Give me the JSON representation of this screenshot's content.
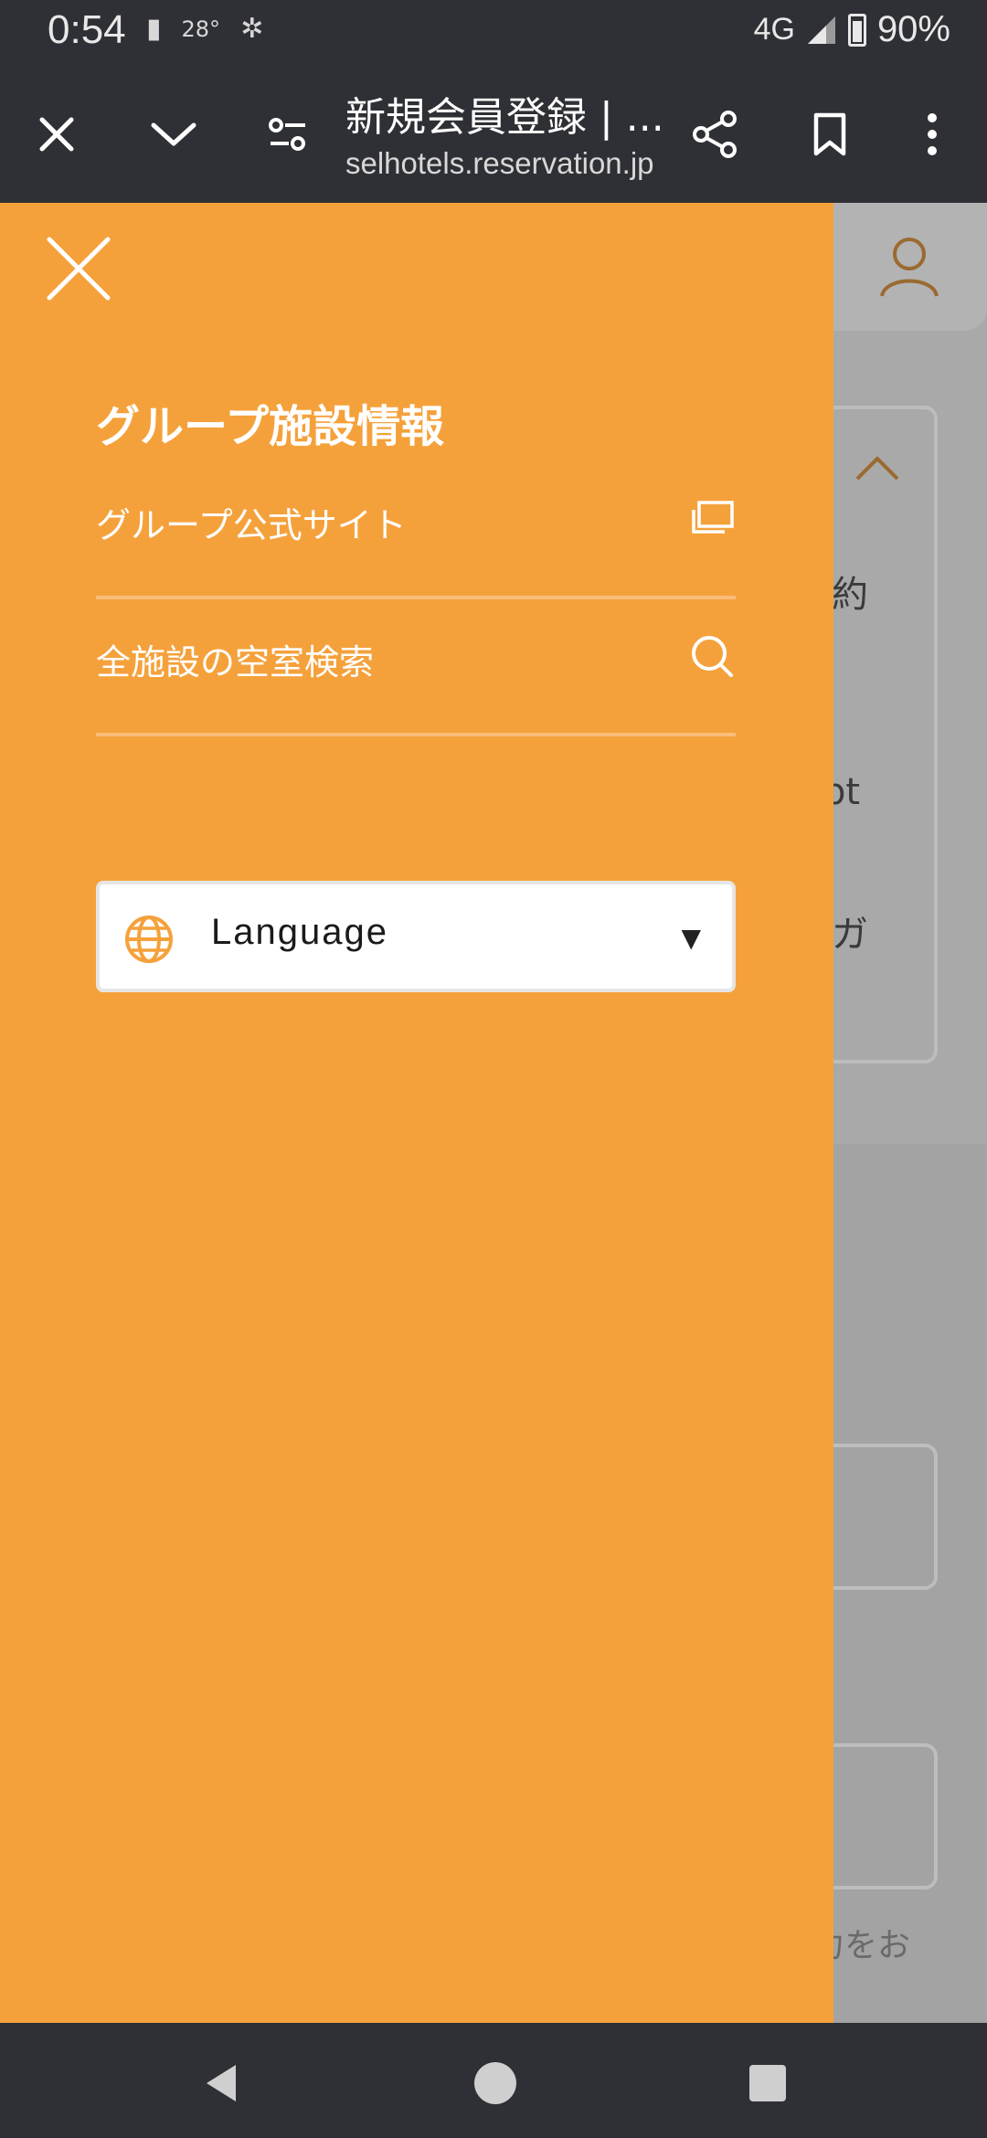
{
  "status_bar": {
    "time": "0:54",
    "temp": "28°",
    "network": "4G",
    "battery": "90%"
  },
  "browser": {
    "title": "新規会員登録 | ...",
    "url": "selhotels.reservation.jp"
  },
  "background_page": {
    "snippets": [
      "約",
      "pt",
      "ガ",
      "力をお"
    ]
  },
  "drawer": {
    "section_title": "グループ施設情報",
    "items": [
      {
        "label": "グループ公式サイト",
        "icon": "external-window-icon"
      },
      {
        "label": "全施設の空室検索",
        "icon": "search-icon"
      }
    ],
    "language": {
      "label": "Language",
      "icon": "globe-icon"
    }
  },
  "colors": {
    "drawer_bg": "#f5a13b",
    "chrome_bg": "#2f3035",
    "scrim": "#a9a9a9"
  }
}
